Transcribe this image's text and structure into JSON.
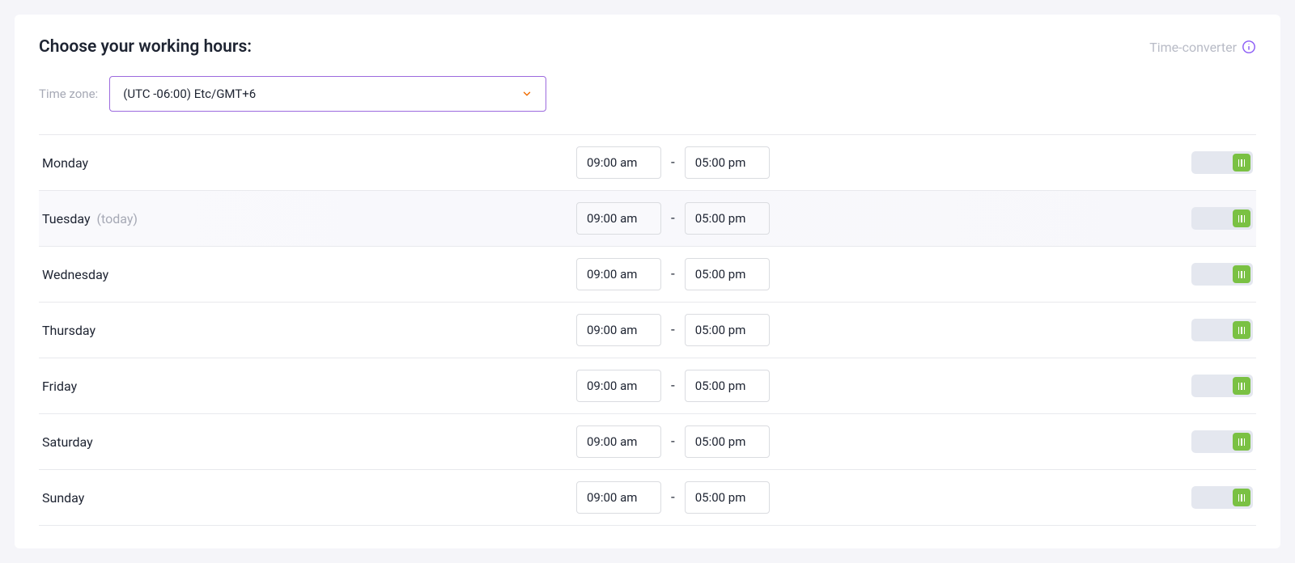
{
  "header": {
    "title": "Choose your working hours:",
    "time_converter_label": "Time-converter"
  },
  "tz": {
    "label": "Time zone:",
    "value": "(UTC -06:00) Etc/GMT+6"
  },
  "today_tag": "(today)",
  "time_separator": "-",
  "days": [
    {
      "label": "Monday",
      "start": "09:00 am",
      "end": "05:00 pm",
      "is_today": false,
      "enabled": true
    },
    {
      "label": "Tuesday",
      "start": "09:00 am",
      "end": "05:00 pm",
      "is_today": true,
      "enabled": true
    },
    {
      "label": "Wednesday",
      "start": "09:00 am",
      "end": "05:00 pm",
      "is_today": false,
      "enabled": true
    },
    {
      "label": "Thursday",
      "start": "09:00 am",
      "end": "05:00 pm",
      "is_today": false,
      "enabled": true
    },
    {
      "label": "Friday",
      "start": "09:00 am",
      "end": "05:00 pm",
      "is_today": false,
      "enabled": true
    },
    {
      "label": "Saturday",
      "start": "09:00 am",
      "end": "05:00 pm",
      "is_today": false,
      "enabled": true
    },
    {
      "label": "Sunday",
      "start": "09:00 am",
      "end": "05:00 pm",
      "is_today": false,
      "enabled": true
    }
  ]
}
